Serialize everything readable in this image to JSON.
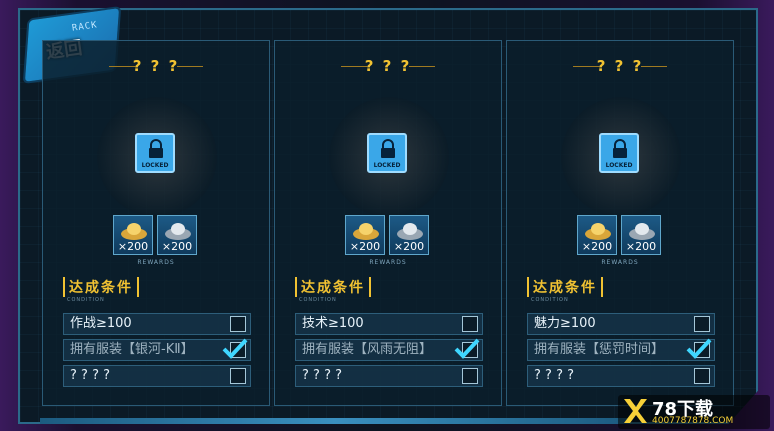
{
  "back_button": {
    "label": "返回",
    "track_label": "RACK"
  },
  "cards": [
    {
      "title": "? ? ?",
      "lock_label": "LOCKED",
      "rewards": [
        {
          "icon": "gold-ingot-icon",
          "count": "×200"
        },
        {
          "icon": "silver-ingot-icon",
          "count": "×200"
        }
      ],
      "rewards_caption": "REWARDS",
      "condition_title": "达成条件",
      "condition_subtitle": "CONDITION",
      "conditions": [
        {
          "text": "作战≥100",
          "checked": false
        },
        {
          "text": "拥有服装【银河-KⅡ】",
          "checked": true
        },
        {
          "text": "? ? ? ?",
          "checked": false
        }
      ]
    },
    {
      "title": "? ? ?",
      "lock_label": "LOCKED",
      "rewards": [
        {
          "icon": "gold-ingot-icon",
          "count": "×200"
        },
        {
          "icon": "silver-ingot-icon",
          "count": "×200"
        }
      ],
      "rewards_caption": "REWARDS",
      "condition_title": "达成条件",
      "condition_subtitle": "CONDITION",
      "conditions": [
        {
          "text": "技术≥100",
          "checked": false
        },
        {
          "text": "拥有服装【风雨无阻】",
          "checked": true
        },
        {
          "text": "? ? ? ?",
          "checked": false
        }
      ]
    },
    {
      "title": "? ? ?",
      "lock_label": "LOCKED",
      "rewards": [
        {
          "icon": "gold-ingot-icon",
          "count": "×200"
        },
        {
          "icon": "silver-ingot-icon",
          "count": "×200"
        }
      ],
      "rewards_caption": "REWARDS",
      "condition_title": "达成条件",
      "condition_subtitle": "CONDITION",
      "conditions": [
        {
          "text": "魅力≥100",
          "checked": false
        },
        {
          "text": "拥有服装【惩罚时间】",
          "checked": true
        },
        {
          "text": "? ? ? ?",
          "checked": false
        }
      ]
    }
  ],
  "watermark": {
    "title": "78下载",
    "subtitle": "4007787878.COM"
  },
  "colors": {
    "accent_gold": "#f1c232",
    "lock_blue": "#3aa7e8",
    "check_teal": "#3fd6ff"
  }
}
